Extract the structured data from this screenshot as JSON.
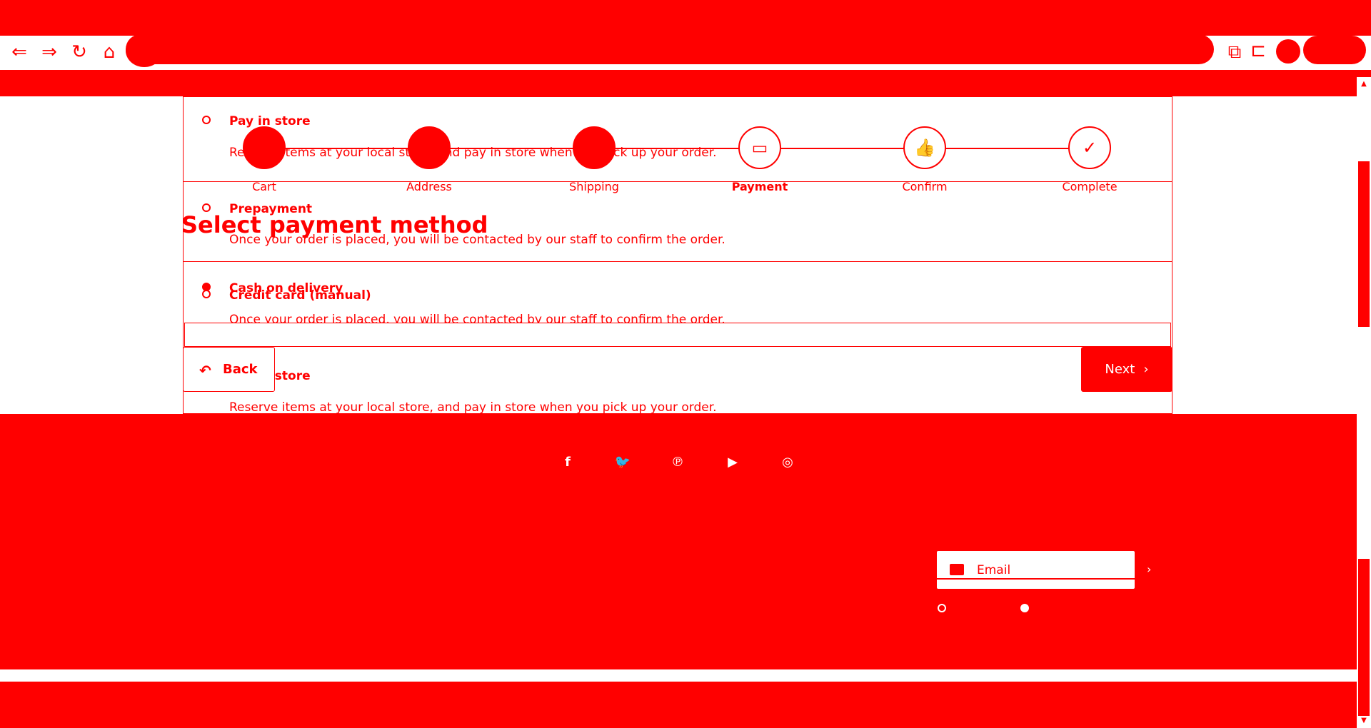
{
  "browser": {
    "nav_icons": [
      "back-arrow-icon",
      "forward-arrow-icon",
      "reload-icon",
      "home-icon"
    ],
    "extension_icons": [
      "puzzle-icon",
      "bookmark-icon"
    ]
  },
  "stepper": {
    "steps": [
      {
        "label": "Cart",
        "state": "done"
      },
      {
        "label": "Address",
        "state": "done"
      },
      {
        "label": "Shipping",
        "state": "done"
      },
      {
        "label": "Payment",
        "state": "active",
        "icon": "credit-card-icon"
      },
      {
        "label": "Confirm",
        "state": "pending",
        "icon": "thumbs-up-icon"
      },
      {
        "label": "Complete",
        "state": "pending",
        "icon": "checkmark-icon"
      }
    ]
  },
  "heading": "Select payment method",
  "payment_options": [
    {
      "title": "Pay in store",
      "description": "Reserve items at your local store, and pay in store when you pick up your order.",
      "selected": false
    },
    {
      "title": "Prepayment",
      "description": "Once your order is placed, you will be contacted by our staff to confirm the order.",
      "selected": false
    },
    {
      "title": "Credit card (manual)",
      "description": "",
      "selected": false
    },
    {
      "title": "Cash on delivery",
      "description": "Once your order is placed, you will be contacted by our staff to confirm the order.",
      "selected": true
    },
    {
      "title": "Pay in store",
      "description": "Reserve items at your local store, and pay in store when you pick up your order.",
      "selected": false
    }
  ],
  "buttons": {
    "back": "Back",
    "next": "Next"
  },
  "footer": {
    "social_icons": [
      "facebook-icon",
      "twitter-icon",
      "pinterest-icon",
      "youtube-icon",
      "instagram-icon"
    ],
    "newsletter": {
      "placeholder": "Email"
    }
  },
  "colors": {
    "brand": "#ff0000",
    "background": "#ffffff"
  }
}
